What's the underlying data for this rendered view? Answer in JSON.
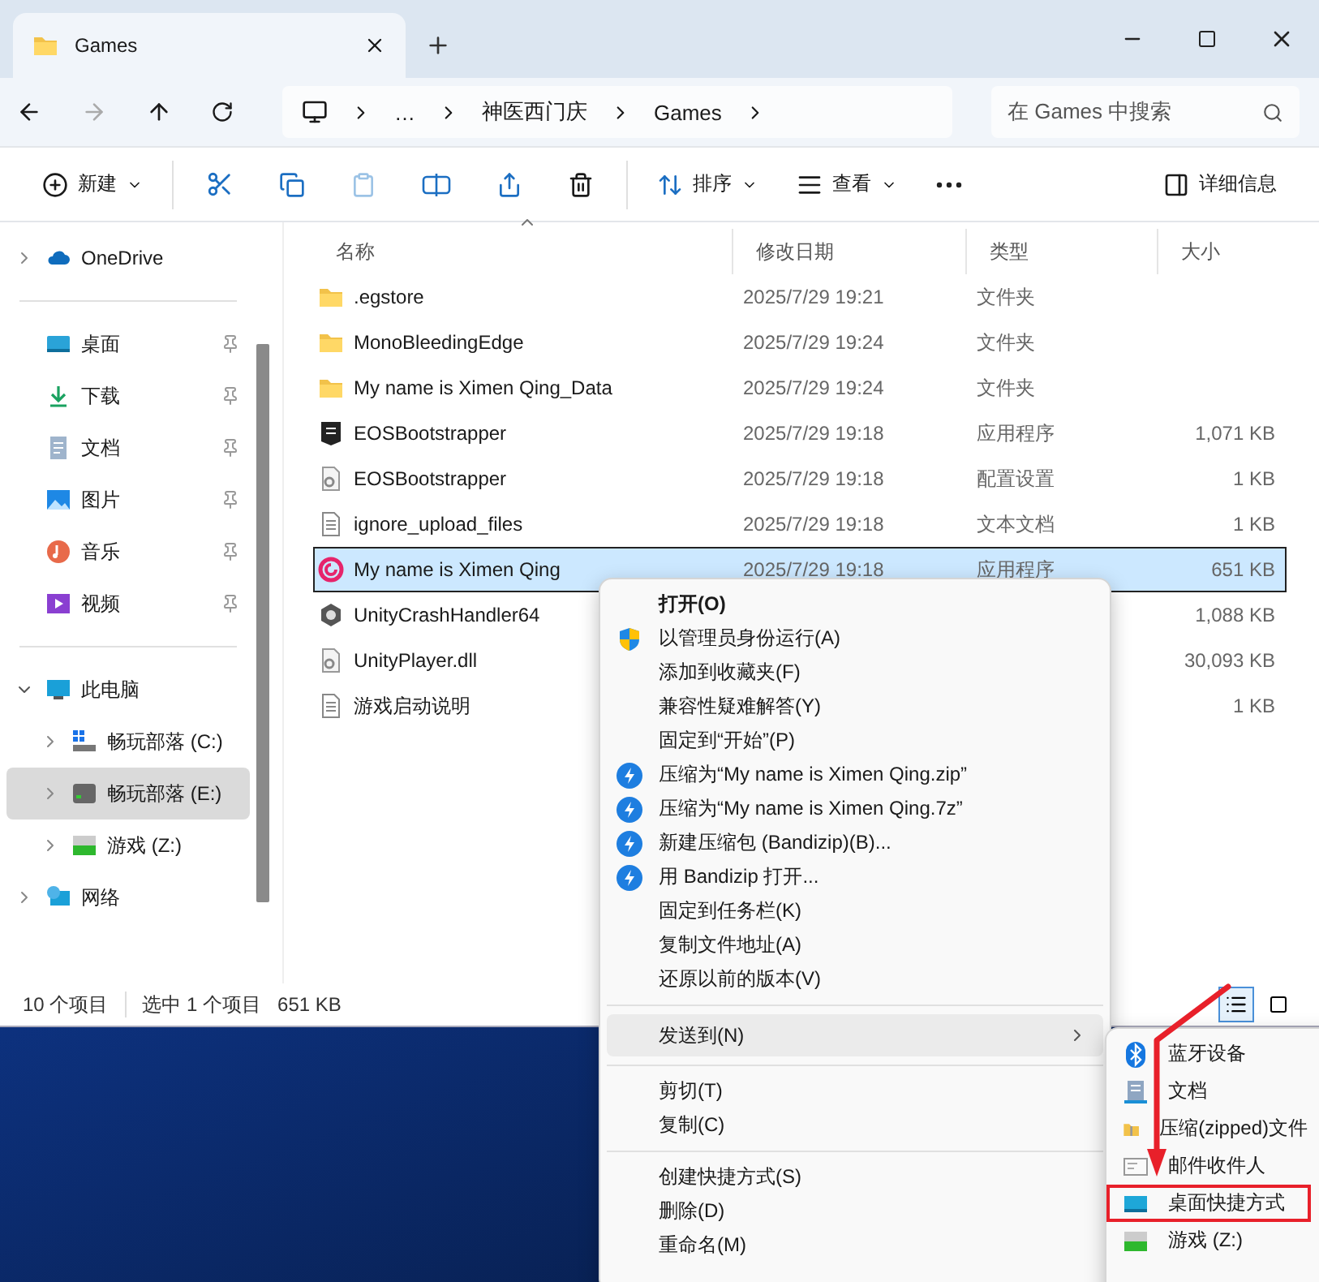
{
  "window": {
    "tab_title": "Games"
  },
  "address": {
    "crumbs": [
      "…",
      "神医西门庆",
      "Games"
    ],
    "search_placeholder": "在 Games 中搜索"
  },
  "toolbar": {
    "new_label": "新建",
    "sort_label": "排序",
    "view_label": "查看",
    "details_label": "详细信息"
  },
  "sidebar": {
    "items": [
      {
        "kind": "cloud",
        "label": "OneDrive",
        "expanded": false,
        "selected": false
      },
      {
        "kind": "divider"
      },
      {
        "kind": "desktop",
        "label": "桌面",
        "selected": false,
        "pinned": true
      },
      {
        "kind": "download",
        "label": "下载",
        "selected": false,
        "pinned": true
      },
      {
        "kind": "document",
        "label": "文档",
        "selected": false,
        "pinned": true
      },
      {
        "kind": "picture",
        "label": "图片",
        "selected": false,
        "pinned": true
      },
      {
        "kind": "music",
        "label": "音乐",
        "selected": false,
        "pinned": true
      },
      {
        "kind": "video",
        "label": "视频",
        "selected": false,
        "pinned": true
      },
      {
        "kind": "divider"
      },
      {
        "kind": "computer",
        "label": "此电脑",
        "expanded": true,
        "selected": false,
        "children": [
          {
            "kind": "systemdrive",
            "label": "畅玩部落 (C:)",
            "expanded": false,
            "selected": false
          },
          {
            "kind": "drive",
            "label": "畅玩部落 (E:)",
            "expanded": false,
            "selected": true
          },
          {
            "kind": "gamedrive",
            "label": "游戏 (Z:)",
            "expanded": false,
            "selected": false
          }
        ]
      },
      {
        "kind": "network",
        "label": "网络",
        "expanded": false,
        "selected": false
      }
    ]
  },
  "table": {
    "columns": [
      "名称",
      "修改日期",
      "类型",
      "大小"
    ],
    "rows": [
      {
        "kind": "folder",
        "name": ".egstore",
        "date": "2025/7/29 19:21",
        "type": "文件夹",
        "selected": false
      },
      {
        "kind": "folder",
        "name": "MonoBleedingEdge",
        "date": "2025/7/29 19:24",
        "type": "文件夹",
        "selected": false
      },
      {
        "kind": "folder",
        "name": "My name is Ximen Qing_Data",
        "date": "2025/7/29 19:24",
        "type": "文件夹",
        "selected": false
      },
      {
        "kind": "epic",
        "name": "EOSBootstrapper",
        "date": "2025/7/29 19:18",
        "type": "应用程序",
        "size": "1,071 KB",
        "selected": false
      },
      {
        "kind": "config",
        "name": "EOSBootstrapper",
        "date": "2025/7/29 19:18",
        "type": "配置设置",
        "size": "1 KB",
        "selected": false
      },
      {
        "kind": "text",
        "name": "ignore_upload_files",
        "date": "2025/7/29 19:18",
        "type": "文本文档",
        "size": "1 KB",
        "selected": false
      },
      {
        "kind": "game",
        "name": "My name is Ximen Qing",
        "date": "2025/7/29 19:18",
        "type": "应用程序",
        "size": "651 KB",
        "selected": true
      },
      {
        "kind": "unity",
        "name": "UnityCrashHandler64",
        "size": "1,088 KB",
        "selected": false
      },
      {
        "kind": "config",
        "name": "UnityPlayer.dll",
        "size": "30,093 KB",
        "selected": false
      },
      {
        "kind": "text",
        "name": "游戏启动说明",
        "size": "1 KB",
        "selected": false
      }
    ]
  },
  "status_bar": {
    "count": "10 个项目",
    "selection": "选中 1 个项目",
    "size": "651 KB",
    "views": [
      {
        "kind": "details",
        "selected": true
      },
      {
        "kind": "tiles",
        "selected": false
      }
    ]
  },
  "context_menu": {
    "items": [
      {
        "kind": "default",
        "label": "打开(O)",
        "selected": false
      },
      {
        "kind": "shield",
        "label": "以管理员身份运行(A)",
        "selected": false
      },
      {
        "kind": "plain",
        "label": "添加到收藏夹(F)",
        "selected": false
      },
      {
        "kind": "plain",
        "label": "兼容性疑难解答(Y)",
        "selected": false
      },
      {
        "kind": "plain",
        "label": "固定到“开始”(P)",
        "selected": false
      },
      {
        "kind": "bandizip",
        "label": "压缩为“My name is Ximen Qing.zip”",
        "selected": false
      },
      {
        "kind": "bandizip",
        "label": "压缩为“My name is Ximen Qing.7z”",
        "selected": false
      },
      {
        "kind": "bandizip",
        "label": "新建压缩包 (Bandizip)(B)...",
        "selected": false
      },
      {
        "kind": "bandizip",
        "label": "用 Bandizip 打开...",
        "selected": false
      },
      {
        "kind": "plain",
        "label": "固定到任务栏(K)",
        "selected": false
      },
      {
        "kind": "plain",
        "label": "复制文件地址(A)",
        "selected": false
      },
      {
        "kind": "plain",
        "label": "还原以前的版本(V)",
        "selected": false
      },
      {
        "kind": "separator"
      },
      {
        "kind": "submenu",
        "label": "发送到(N)",
        "selected": true
      },
      {
        "kind": "separator"
      },
      {
        "kind": "plain",
        "label": "剪切(T)",
        "selected": false
      },
      {
        "kind": "plain",
        "label": "复制(C)",
        "selected": false
      },
      {
        "kind": "separator"
      },
      {
        "kind": "plain",
        "label": "创建快捷方式(S)",
        "selected": false
      },
      {
        "kind": "plain",
        "label": "删除(D)",
        "selected": false
      },
      {
        "kind": "plain",
        "label": "重命名(M)",
        "selected": false
      }
    ]
  },
  "send_to_menu": {
    "items": [
      {
        "kind": "bluetooth",
        "label": "蓝牙设备",
        "marked": false
      },
      {
        "kind": "document",
        "label": "文档",
        "marked": false
      },
      {
        "kind": "zip",
        "label": "压缩(zipped)文件",
        "marked": false
      },
      {
        "kind": "mail",
        "label": "邮件收件人",
        "marked": false
      },
      {
        "kind": "desktop",
        "label": "桌面快捷方式",
        "marked": true
      },
      {
        "kind": "gamedrive",
        "label": "游戏 (Z:)",
        "marked": false
      }
    ]
  }
}
